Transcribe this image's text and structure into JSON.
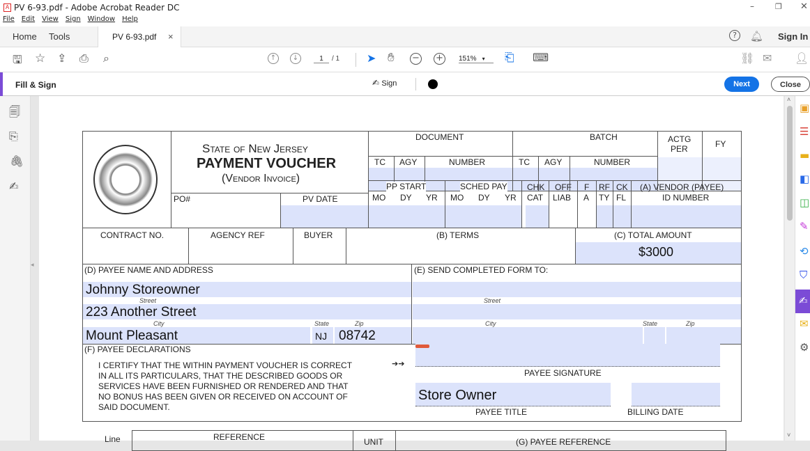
{
  "window": {
    "title": "PV 6-93.pdf - Adobe Acrobat Reader DC"
  },
  "menu": [
    "File",
    "Edit",
    "View",
    "Sign",
    "Window",
    "Help"
  ],
  "tabs": {
    "home": "Home",
    "tools": "Tools",
    "doc": "PV 6-93.pdf",
    "close": "×",
    "signin": "Sign In"
  },
  "toolbar": {
    "page": "1",
    "page_total": "/ 1",
    "zoom": "151%"
  },
  "fillsign": {
    "title": "Fill & Sign",
    "sign": "Sign",
    "next": "Next",
    "close": "Close"
  },
  "form": {
    "state": "State of New Jersey",
    "title": "PAYMENT VOUCHER",
    "subtitle": "(Vendor Invoice)",
    "po": "PO#",
    "pv_date": "PV DATE",
    "document": "DOCUMENT",
    "batch": "BATCH",
    "actg": "ACTG",
    "per": "PER",
    "fy": "FY",
    "tc": "TC",
    "agy": "AGY",
    "number": "NUMBER",
    "pp_start": "PP START",
    "sched_pay": "SCHED PAY",
    "mo": "MO",
    "dy": "DY",
    "yr": "YR",
    "chk": "CHK",
    "cat": "CAT",
    "off": "OFF",
    "liab": "LIAB",
    "f": "F",
    "a": "A",
    "rf": "RF",
    "ty": "TY",
    "ck": "CK",
    "fl": "FL",
    "vendor": "(A) VENDOR (PAYEE)",
    "id_number": "ID NUMBER",
    "contract": "CONTRACT NO.",
    "agency_ref": "AGENCY REF",
    "buyer": "BUYER",
    "terms": "(B) TERMS",
    "total": "(C) TOTAL AMOUNT",
    "total_value": "$3000",
    "payee_hdr": "(D) PAYEE NAME AND ADDRESS",
    "send_hdr": "(E) SEND COMPLETED FORM TO:",
    "street": "Street",
    "city": "City",
    "state_lbl": "State",
    "zip": "Zip",
    "payee_name": "Johnny Storeowner",
    "payee_street": "223 Another Street",
    "payee_city": "Mount Pleasant",
    "payee_state": "NJ",
    "payee_zip": "08742",
    "decl_hdr": "(F) PAYEE DECLARATIONS",
    "decl1": "I CERTIFY THAT THE WITHIN PAYMENT VOUCHER IS CORRECT",
    "decl2": "IN ALL ITS PARTICULARS, THAT THE DESCRIBED GOODS OR",
    "decl3": "SERVICES HAVE BEEN FURNISHED OR RENDERED AND THAT",
    "decl4": "NO BONUS HAS BEEN GIVEN OR RECEIVED ON ACCOUNT OF",
    "decl5": "SAID DOCUMENT.",
    "arrows": "➔➔",
    "sig": "PAYEE SIGNATURE",
    "payee_title_lbl": "PAYEE TITLE",
    "billing_date": "BILLING DATE",
    "payee_title": "Store Owner",
    "line": "Line",
    "reference": "REFERENCE",
    "unit": "UNIT",
    "payee_ref": "(G) PAYEE REFERENCE"
  }
}
